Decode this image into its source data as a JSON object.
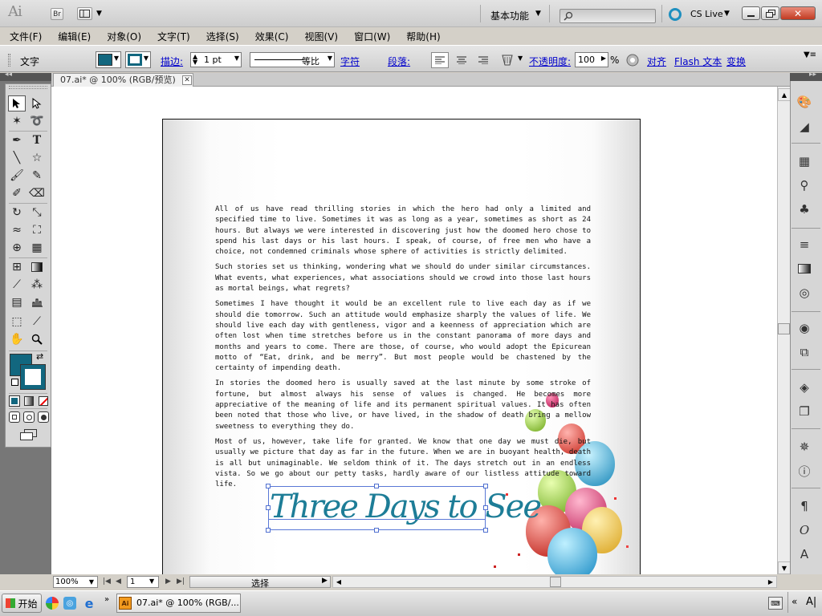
{
  "app": {
    "logo": "Ai",
    "bridge_label": "Br",
    "workspace_label": "基本功能",
    "search_placeholder": "",
    "cslive_label": "CS Live"
  },
  "menubar": {
    "items": [
      "文件(F)",
      "编辑(E)",
      "对象(O)",
      "文字(T)",
      "选择(S)",
      "效果(C)",
      "视图(V)",
      "窗口(W)",
      "帮助(H)"
    ]
  },
  "control_bar": {
    "mode_label": "文字",
    "stroke_label": "描边:",
    "stroke_weight": "1 pt",
    "stroke_style_label": "等比",
    "character_label": "字符",
    "paragraph_label": "段落:",
    "opacity_label": "不透明度:",
    "opacity_value": "100",
    "opacity_unit": "%",
    "align_label": "对齐",
    "flash_text_label": "Flash 文本",
    "transform_label": "变换",
    "fill_color": "#12677f"
  },
  "document": {
    "tab_title": "07.ai* @ 100% (RGB/预览)",
    "paragraphs": [
      "All of us have read thrilling stories in which the hero had only a limited and specified time to live. Sometimes it was as long as a year, sometimes as short as 24 hours. But always we were interested in discovering just how the doomed hero chose to spend his last days or his last hours. I speak, of course, of free men who have a choice, not condemned criminals whose sphere of activities is strictly delimited.",
      "Such stories set us thinking, wondering what we should do under similar circumstances. What events, what experiences, what associations should we crowd into those last hours as mortal beings, what regrets?",
      "Sometimes I have thought it would be an excellent rule to live each day as if we should die tomorrow. Such an attitude would emphasize sharply the values of life. We should live each day with gentleness, vigor and a keenness of appreciation which are often lost when time stretches before us in the constant panorama of more days and months and years to come. There are those, of course, who would adopt the Epicurean motto of “Eat, drink, and be merry”. But most people would be chastened by the certainty of impending death.",
      "In stories the doomed hero is usually saved at the last minute by some stroke of fortune, but almost always his sense of values is changed. He becomes more appreciative of the meaning of life and its permanent spiritual values. It has often been noted that those who live, or have lived, in the shadow of death bring a mellow sweetness to everything they do.",
      "Most of us, however, take life for granted. We know that one day we must die, but usually we picture that day as far in the future. When we are in buoyant health, death is all but unimaginable. We seldom think of it. The days stretch out in an endless vista. So we go about our petty tasks, hardly aware of our listless attitude toward life."
    ],
    "headline": "Three Days to See",
    "headline_color": "#1d7d97"
  },
  "status_bar": {
    "zoom": "100%",
    "page": "1",
    "status": "选择"
  },
  "taskbar": {
    "start_label": "开始",
    "task_label": "07.ai* @ 100% (RGB/...",
    "tray_lang": "A|"
  }
}
